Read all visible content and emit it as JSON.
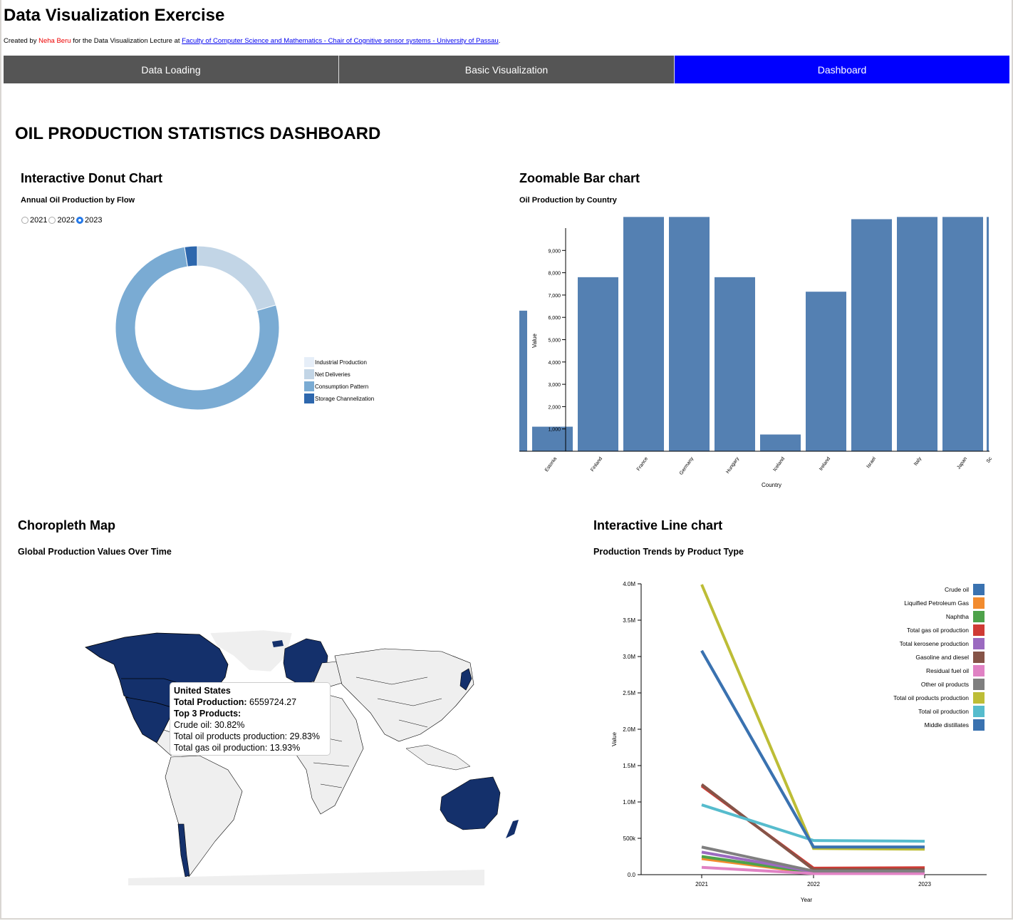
{
  "header": {
    "title": "Data Visualization Exercise",
    "credit_prefix": "Created by",
    "author": "Neha Beru",
    "credit_middle": "for the Data Visualization Lecture at",
    "affiliation_link": "Faculty of Computer Science and Mathematics - Chair of Cognitive sensor systems - University of Passau",
    "credit_suffix": "."
  },
  "tabs": [
    {
      "label": "Data Loading",
      "active": false
    },
    {
      "label": "Basic Visualization",
      "active": false
    },
    {
      "label": "Dashboard",
      "active": true
    }
  ],
  "dashboard_title": "OIL PRODUCTION STATISTICS DASHBOARD",
  "donut": {
    "title": "Interactive Donut Chart",
    "subtitle": "Annual Oil Production by Flow",
    "years": [
      "2021",
      "2022",
      "2023"
    ],
    "selected_year": "2023"
  },
  "bar": {
    "title": "Zoomable Bar chart",
    "subtitle": "Oil Production by Country"
  },
  "map": {
    "title": "Choropleth Map",
    "subtitle": "Global Production Values Over Time",
    "tooltip": {
      "country": "United States",
      "total_label": "Total Production:",
      "total_value": "6559724.27",
      "top_label": "Top 3 Products:",
      "products": [
        "Crude oil: 30.82%",
        "Total oil products production: 29.83%",
        "Total gas oil production: 13.93%"
      ]
    },
    "colors": {
      "high": "#14306b",
      "none": "#efefef"
    }
  },
  "line": {
    "title": "Interactive Line chart",
    "subtitle": "Production Trends by Product Type"
  },
  "chart_data": [
    {
      "type": "pie",
      "variant": "donut",
      "categories": [
        "Industrial Production",
        "Net Deliveries",
        "Consumption Pattern",
        "Storage Channelization"
      ],
      "values": [
        0,
        20.5,
        77,
        2.5
      ],
      "colors": [
        "#e6eef8",
        "#c2d5e6",
        "#7aabd3",
        "#2d67ad"
      ],
      "legend": "right"
    },
    {
      "type": "bar",
      "categories": [
        "",
        "Estonia",
        "Finland",
        "France",
        "Germany",
        "Hungary",
        "Iceland",
        "Ireland",
        "Israel",
        "Italy",
        "Japan",
        "Sc"
      ],
      "values": [
        6300,
        1100,
        7800,
        10500,
        10500,
        7800,
        750,
        7150,
        10400,
        10500,
        10500,
        10500
      ],
      "xlabel": "Country",
      "ylabel": "Value",
      "yticks": [
        "1,000",
        "2,000",
        "3,000",
        "4,000",
        "5,000",
        "6,000",
        "7,000",
        "8,000",
        "9,000"
      ],
      "ylim": [
        0,
        10000
      ],
      "color": "#5480b2"
    },
    {
      "type": "line",
      "x": [
        "2021",
        "2022",
        "2023"
      ],
      "xlabel": "Year",
      "ylabel": "Value",
      "yticks": [
        "0.0",
        "500k",
        "1.0M",
        "1.5M",
        "2.0M",
        "2.5M",
        "3.0M",
        "3.5M",
        "4.0M"
      ],
      "ylim": [
        0,
        4000000
      ],
      "legend": "top-right",
      "series": [
        {
          "name": "Crude oil",
          "color": "#3a72b0",
          "values": [
            3080000,
            380000,
            380000
          ]
        },
        {
          "name": "Liquified Petroleum Gas",
          "color": "#f28b2e",
          "values": [
            220000,
            25000,
            25000
          ]
        },
        {
          "name": "Naphtha",
          "color": "#4ea24a",
          "values": [
            250000,
            30000,
            30000
          ]
        },
        {
          "name": "Total gas oil production",
          "color": "#cf3b35",
          "values": [
            1220000,
            90000,
            95000
          ]
        },
        {
          "name": "Total kerosene production",
          "color": "#9b6ac0",
          "values": [
            310000,
            40000,
            40000
          ]
        },
        {
          "name": "Gasoline and diesel",
          "color": "#865448",
          "values": [
            1240000,
            70000,
            70000
          ]
        },
        {
          "name": "Residual fuel oil",
          "color": "#e082c4",
          "values": [
            100000,
            15000,
            15000
          ]
        },
        {
          "name": "Other oil products",
          "color": "#7f7f7f",
          "values": [
            380000,
            50000,
            50000
          ]
        },
        {
          "name": "Total oil products production",
          "color": "#bdbd36",
          "values": [
            3990000,
            360000,
            350000
          ]
        },
        {
          "name": "Total oil production",
          "color": "#56bccd",
          "values": [
            960000,
            470000,
            460000
          ]
        },
        {
          "name": "Middle distillates",
          "color": "#3a72b0",
          "values": [
            3080000,
            380000,
            380000
          ]
        }
      ]
    }
  ]
}
